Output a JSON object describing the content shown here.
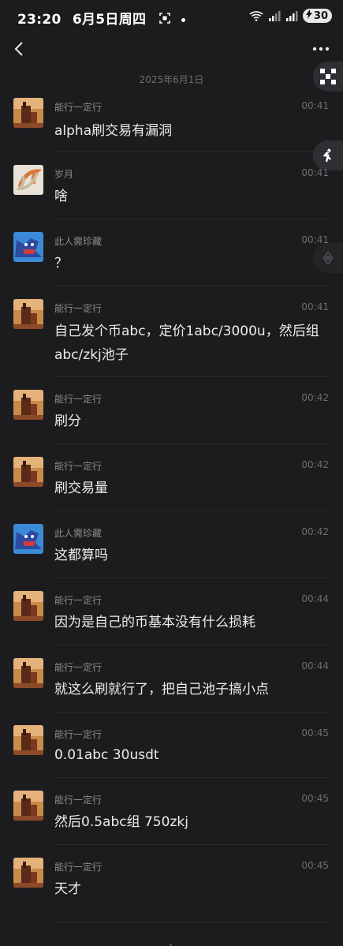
{
  "status_bar": {
    "time": "23:20",
    "date": "6月5日周四",
    "battery": "30"
  },
  "date_separator": "2025年6月1日",
  "messages": [
    {
      "sender": "能行一定行",
      "time": "00:41",
      "text": "alpha刷交易有漏洞",
      "avatar": "castle"
    },
    {
      "sender": "岁月",
      "time": "00:41",
      "text": "啥",
      "avatar": "koi"
    },
    {
      "sender": "此人需珍藏",
      "time": "00:41",
      "text": "？",
      "avatar": "cartoon"
    },
    {
      "sender": "能行一定行",
      "time": "00:41",
      "text": "自己发个币abc，定价1abc/3000u，然后组abc/zkj池子",
      "avatar": "castle"
    },
    {
      "sender": "能行一定行",
      "time": "00:42",
      "text": "刷分",
      "avatar": "castle"
    },
    {
      "sender": "能行一定行",
      "time": "00:42",
      "text": "刷交易量",
      "avatar": "castle"
    },
    {
      "sender": "此人需珍藏",
      "time": "00:42",
      "text": "这都算吗",
      "avatar": "cartoon"
    },
    {
      "sender": "能行一定行",
      "time": "00:44",
      "text": "因为是自己的币基本没有什么损耗",
      "avatar": "castle"
    },
    {
      "sender": "能行一定行",
      "time": "00:44",
      "text": "就这么刷就行了，把自己池子搞小点",
      "avatar": "castle"
    },
    {
      "sender": "能行一定行",
      "time": "00:45",
      "text": "0.01abc 30usdt",
      "avatar": "castle"
    },
    {
      "sender": "能行一定行",
      "time": "00:45",
      "text": "然后0.5abc组 750zkj",
      "avatar": "castle"
    },
    {
      "sender": "能行一定行",
      "time": "00:45",
      "text": "天才",
      "avatar": "castle"
    }
  ],
  "icons": {
    "back": "chevron-left-icon",
    "more": "more-dots-icon",
    "float_1": "qr-code-icon",
    "float_2": "share-arrows-icon",
    "float_3": "binance-icon"
  }
}
